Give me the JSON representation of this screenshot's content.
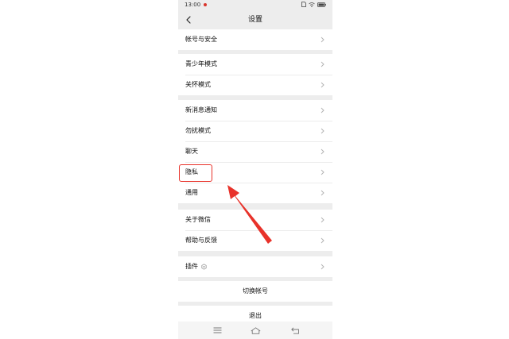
{
  "status_bar": {
    "time": "13:00",
    "icons": [
      "notification-dot-icon",
      "sim-icon",
      "wifi-icon",
      "battery-icon"
    ]
  },
  "nav": {
    "title": "设置",
    "back_icon": "chevron-left-icon"
  },
  "groups": [
    {
      "items": [
        {
          "label": "帐号与安全"
        }
      ]
    },
    {
      "items": [
        {
          "label": "青少年模式"
        },
        {
          "label": "关怀模式"
        }
      ]
    },
    {
      "items": [
        {
          "label": "新消息通知"
        },
        {
          "label": "勿扰模式"
        },
        {
          "label": "聊天"
        },
        {
          "label": "隐私"
        },
        {
          "label": "通用"
        }
      ]
    },
    {
      "items": [
        {
          "label": "关于微信"
        },
        {
          "label": "帮助与反馈"
        }
      ]
    },
    {
      "items": [
        {
          "label": "插件",
          "extra_icon": "plugin-icon"
        }
      ]
    }
  ],
  "actions": {
    "switch_account": "切换帐号",
    "logout": "退出"
  },
  "system_nav": {
    "icons": [
      "menu-icon",
      "home-icon",
      "back-icon"
    ]
  },
  "annotation": {
    "highlighted_item": "隐私",
    "color": "#e8322a"
  },
  "colors": {
    "page_background": "#ededed",
    "cell_background": "#ffffff",
    "separator": "#ececec",
    "chevron": "#b5b5b5",
    "annotation": "#e8322a"
  }
}
